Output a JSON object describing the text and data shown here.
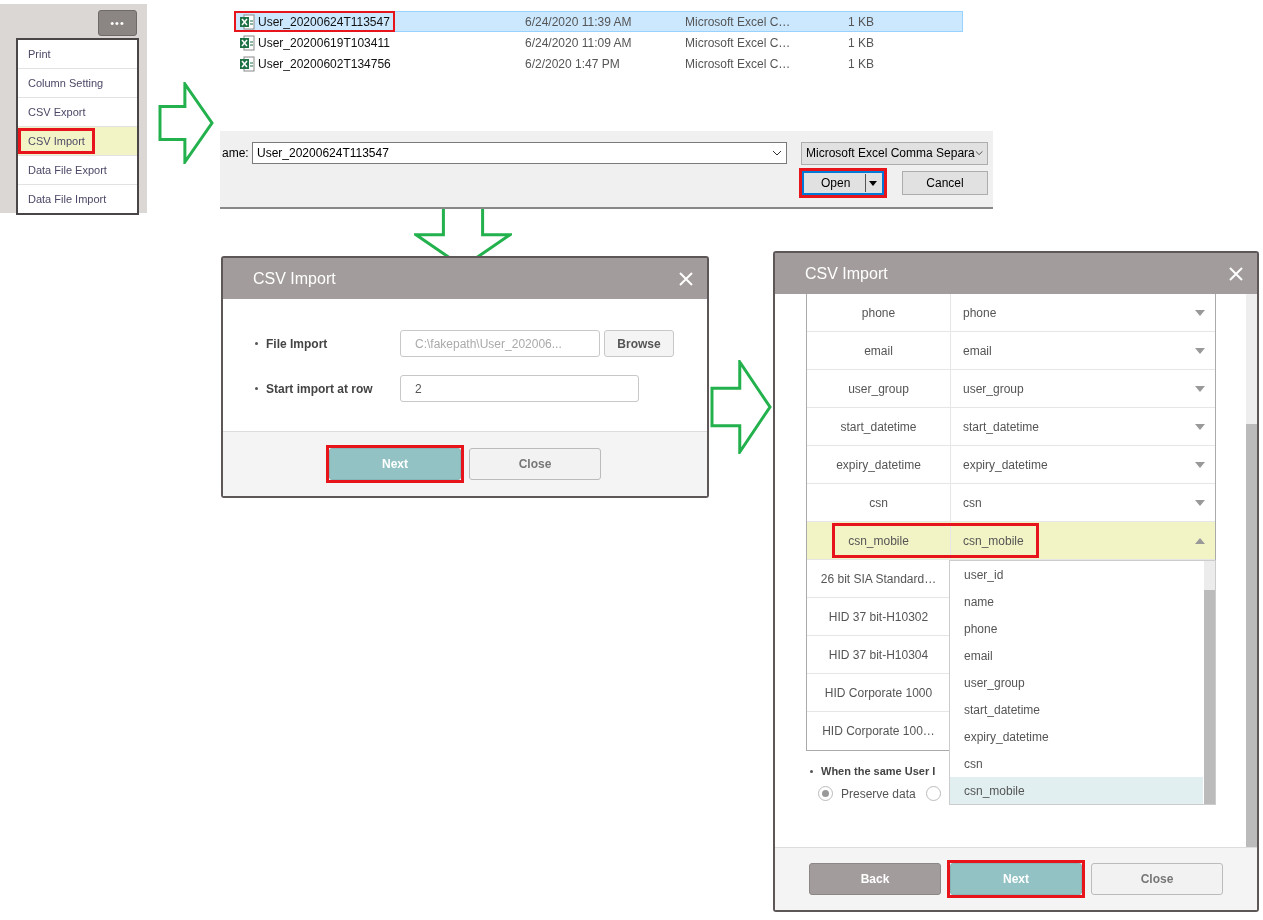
{
  "menu": {
    "more_button": "•••",
    "items": [
      {
        "label": "Print",
        "selected": false,
        "highlighted": false
      },
      {
        "label": "Column Setting",
        "selected": false,
        "highlighted": false
      },
      {
        "label": "CSV Export",
        "selected": false,
        "highlighted": false
      },
      {
        "label": "CSV Import",
        "selected": true,
        "highlighted": true
      },
      {
        "label": "Data File Export",
        "selected": false,
        "highlighted": false
      },
      {
        "label": "Data File Import",
        "selected": false,
        "highlighted": false
      }
    ]
  },
  "arrows": [
    {
      "kind": "right"
    },
    {
      "kind": "down"
    },
    {
      "kind": "right"
    }
  ],
  "file_dialog": {
    "files": [
      {
        "name": "User_20200624T113547",
        "date": "6/24/2020 11:39 AM",
        "type": "Microsoft Excel C…",
        "size": "1 KB",
        "selected": true,
        "highlighted": true
      },
      {
        "name": "User_20200619T103411",
        "date": "6/24/2020 11:09 AM",
        "type": "Microsoft Excel C…",
        "size": "1 KB",
        "selected": false,
        "highlighted": false
      },
      {
        "name": "User_20200602T134756",
        "date": "6/2/2020 1:47 PM",
        "type": "Microsoft Excel C…",
        "size": "1 KB",
        "selected": false,
        "highlighted": false
      }
    ],
    "filename_label": "ame:",
    "filename": "User_20200624T113547",
    "filetype": "Microsoft Excel Comma Separa",
    "buttons": [
      {
        "label": "Open",
        "kind": "split",
        "highlighted": true
      },
      {
        "label": "Cancel",
        "kind": "plain",
        "highlighted": false
      }
    ]
  },
  "import_dialog": {
    "title": "CSV Import",
    "fields": [
      {
        "label": "File Import",
        "value": "C:\\fakepath\\User_202006...",
        "kind": "file",
        "disabled": true,
        "button": "Browse"
      },
      {
        "label": "Start import at row",
        "value": "2",
        "kind": "text",
        "disabled": false
      }
    ],
    "buttons": [
      {
        "label": "Next",
        "kind": "primary",
        "highlighted": true
      },
      {
        "label": "Close",
        "kind": "secondary",
        "highlighted": false
      }
    ]
  },
  "mapping_dialog": {
    "title": "CSV Import",
    "mappings": [
      {
        "column": "phone",
        "field": "phone",
        "expanded": false,
        "selected": false,
        "highlighted": false
      },
      {
        "column": "email",
        "field": "email",
        "expanded": false,
        "selected": false,
        "highlighted": false
      },
      {
        "column": "user_group",
        "field": "user_group",
        "expanded": false,
        "selected": false,
        "highlighted": false
      },
      {
        "column": "start_datetime",
        "field": "start_datetime",
        "expanded": false,
        "selected": false,
        "highlighted": false
      },
      {
        "column": "expiry_datetime",
        "field": "expiry_datetime",
        "expanded": false,
        "selected": false,
        "highlighted": false
      },
      {
        "column": "csn",
        "field": "csn",
        "expanded": false,
        "selected": false,
        "highlighted": false
      },
      {
        "column": "csn_mobile",
        "field": "csn_mobile",
        "expanded": true,
        "selected": true,
        "highlighted": true
      },
      {
        "column": "26 bit SIA Standard…",
        "selected": false,
        "highlighted": false
      },
      {
        "column": "HID 37 bit-H10302",
        "selected": false,
        "highlighted": false
      },
      {
        "column": "HID 37 bit-H10304",
        "selected": false,
        "highlighted": false
      },
      {
        "column": "HID Corporate 1000",
        "selected": false,
        "highlighted": false
      },
      {
        "column": "HID Corporate 100…",
        "selected": false,
        "highlighted": false
      }
    ],
    "options": [
      {
        "label": "user_id",
        "selected": false
      },
      {
        "label": "name",
        "selected": false
      },
      {
        "label": "phone",
        "selected": false
      },
      {
        "label": "email",
        "selected": false
      },
      {
        "label": "user_group",
        "selected": false
      },
      {
        "label": "start_datetime",
        "selected": false
      },
      {
        "label": "expiry_datetime",
        "selected": false
      },
      {
        "label": "csn",
        "selected": false
      },
      {
        "label": "csn_mobile",
        "selected": true
      }
    ],
    "duplicate_label": "When the same User I",
    "radios": [
      {
        "label": "Preserve data",
        "selected": true
      },
      {
        "selected": false
      }
    ],
    "buttons": [
      {
        "label": "Back",
        "kind": "back",
        "highlighted": false
      },
      {
        "label": "Next",
        "kind": "primary",
        "highlighted": true
      },
      {
        "label": "Close",
        "kind": "secondary",
        "highlighted": false
      }
    ]
  }
}
